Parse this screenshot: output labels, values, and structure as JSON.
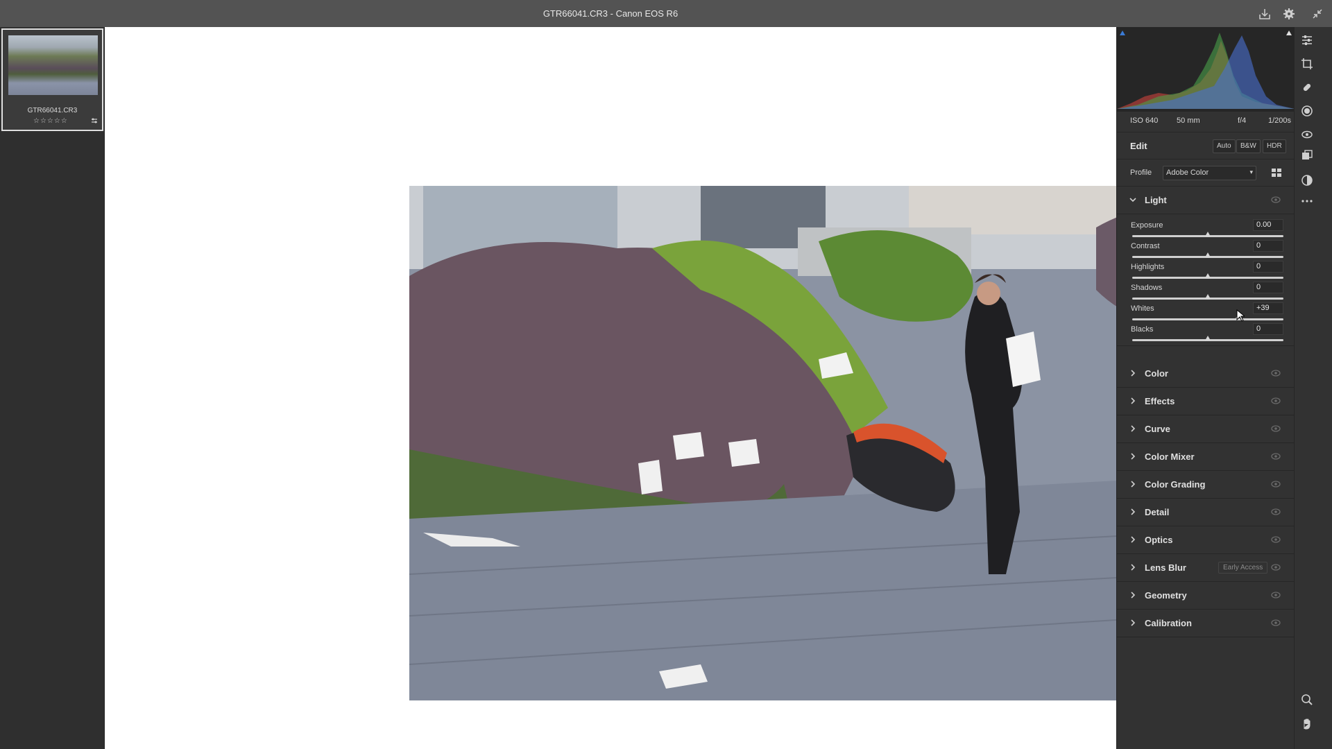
{
  "window": {
    "title": "GTR66041.CR3  -  Canon EOS R6"
  },
  "filmstrip": {
    "items": [
      {
        "filename": "GTR66041.CR3",
        "stars": "☆☆☆☆☆",
        "edited_icon": "sliders-icon"
      }
    ]
  },
  "exif": {
    "iso": "ISO 640",
    "focal": "50 mm",
    "aperture": "f/4",
    "shutter": "1/200s"
  },
  "edit": {
    "label": "Edit",
    "auto": "Auto",
    "bw": "B&W",
    "hdr": "HDR"
  },
  "profile": {
    "label": "Profile",
    "value": "Adobe Color"
  },
  "light": {
    "name": "Light",
    "sliders": [
      {
        "label": "Exposure",
        "value": "0.00",
        "level": 0.5,
        "track": "#d0d0d0"
      },
      {
        "label": "Contrast",
        "value": "0",
        "level": 0.5,
        "track": "#d0d0d0"
      },
      {
        "label": "Highlights",
        "value": "0",
        "level": 0.5,
        "track": "#d0d0d0"
      },
      {
        "label": "Shadows",
        "value": "0",
        "level": 0.5,
        "track": "#d0d0d0"
      },
      {
        "label": "Whites",
        "value": "+39",
        "level": 0.695,
        "track": "#d0d0d0"
      },
      {
        "label": "Blacks",
        "value": "0",
        "level": 0.5,
        "track": "#d0d0d0"
      }
    ]
  },
  "sections": [
    {
      "name": "Color"
    },
    {
      "name": "Effects"
    },
    {
      "name": "Curve"
    },
    {
      "name": "Color Mixer"
    },
    {
      "name": "Color Grading"
    },
    {
      "name": "Detail"
    },
    {
      "name": "Optics"
    },
    {
      "name": "Lens Blur",
      "badge": "Early Access"
    },
    {
      "name": "Geometry"
    },
    {
      "name": "Calibration"
    }
  ],
  "colors": {
    "panel_bg": "#323232",
    "canvas_bg": "#ffffff",
    "titlebar_bg": "#535353"
  }
}
